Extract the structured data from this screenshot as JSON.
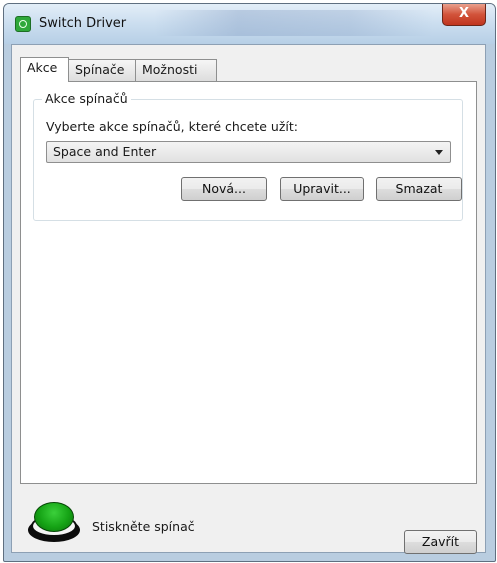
{
  "window": {
    "title": "Switch Driver",
    "close_glyph": "X",
    "icon": "switch-driver-app-icon"
  },
  "tabs": [
    {
      "label": "Akce",
      "active": true
    },
    {
      "label": "Spínače",
      "active": false
    },
    {
      "label": "Možnosti",
      "active": false
    }
  ],
  "actions_group": {
    "title": "Akce spínačů",
    "prompt": "Vyberte akce spínačů, které chcete užít:",
    "selected_action": "Space and Enter",
    "buttons": {
      "new": "Nová...",
      "edit": "Upravit...",
      "delete": "Smazat"
    }
  },
  "footer": {
    "status_text": "Stiskněte spínač",
    "indicator": "green-switch-button",
    "indicator_color": "#15a315",
    "close_button": "Zavřít"
  }
}
